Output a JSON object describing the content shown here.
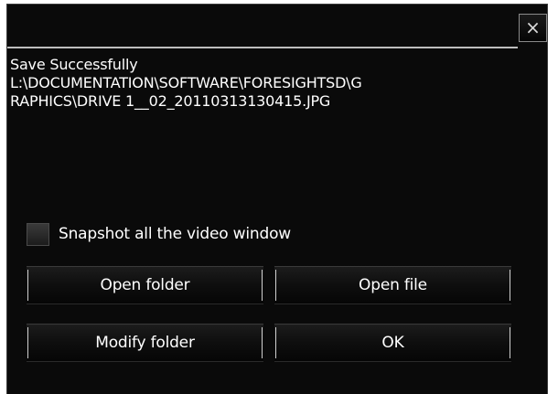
{
  "dialog": {
    "close_label": "×",
    "message": {
      "line1": "Save Successfully",
      "line2": "L:\\DOCUMENTATION\\SOFTWARE\\FORESIGHTSD\\G",
      "line3": "RAPHICS\\DRIVE 1__02_20110313130415.JPG"
    },
    "checkbox": {
      "label": "Snapshot all the video window",
      "checked": false
    },
    "buttons": {
      "open_folder": "Open folder",
      "open_file": "Open file",
      "modify_folder": "Modify folder",
      "ok": "OK"
    }
  },
  "colors": {
    "background": "#0a0a0a",
    "text": "#ffffff",
    "separator": "#bdbdbd"
  }
}
